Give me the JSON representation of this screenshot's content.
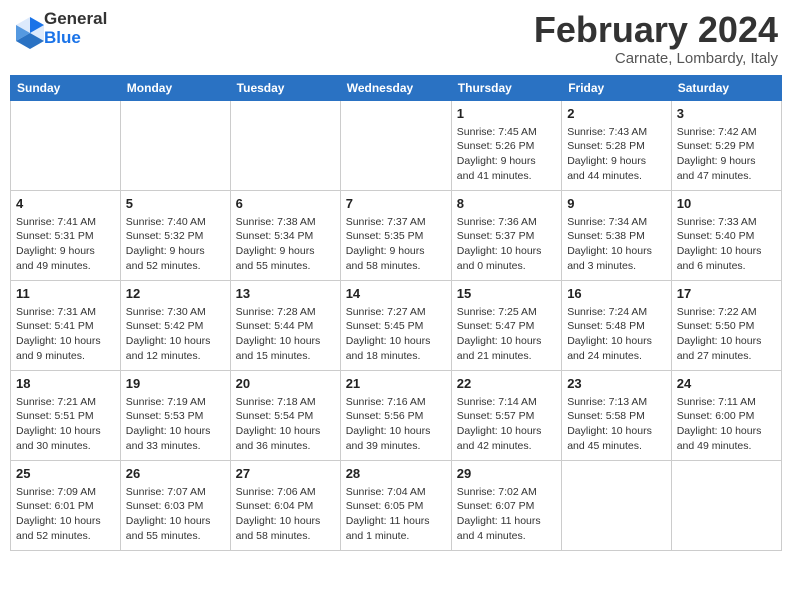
{
  "header": {
    "logo_line1": "General",
    "logo_line2": "Blue",
    "title": "February 2024",
    "subtitle": "Carnate, Lombardy, Italy"
  },
  "weekdays": [
    "Sunday",
    "Monday",
    "Tuesday",
    "Wednesday",
    "Thursday",
    "Friday",
    "Saturday"
  ],
  "weeks": [
    [
      {
        "day": "",
        "info": ""
      },
      {
        "day": "",
        "info": ""
      },
      {
        "day": "",
        "info": ""
      },
      {
        "day": "",
        "info": ""
      },
      {
        "day": "1",
        "info": "Sunrise: 7:45 AM\nSunset: 5:26 PM\nDaylight: 9 hours\nand 41 minutes."
      },
      {
        "day": "2",
        "info": "Sunrise: 7:43 AM\nSunset: 5:28 PM\nDaylight: 9 hours\nand 44 minutes."
      },
      {
        "day": "3",
        "info": "Sunrise: 7:42 AM\nSunset: 5:29 PM\nDaylight: 9 hours\nand 47 minutes."
      }
    ],
    [
      {
        "day": "4",
        "info": "Sunrise: 7:41 AM\nSunset: 5:31 PM\nDaylight: 9 hours\nand 49 minutes."
      },
      {
        "day": "5",
        "info": "Sunrise: 7:40 AM\nSunset: 5:32 PM\nDaylight: 9 hours\nand 52 minutes."
      },
      {
        "day": "6",
        "info": "Sunrise: 7:38 AM\nSunset: 5:34 PM\nDaylight: 9 hours\nand 55 minutes."
      },
      {
        "day": "7",
        "info": "Sunrise: 7:37 AM\nSunset: 5:35 PM\nDaylight: 9 hours\nand 58 minutes."
      },
      {
        "day": "8",
        "info": "Sunrise: 7:36 AM\nSunset: 5:37 PM\nDaylight: 10 hours\nand 0 minutes."
      },
      {
        "day": "9",
        "info": "Sunrise: 7:34 AM\nSunset: 5:38 PM\nDaylight: 10 hours\nand 3 minutes."
      },
      {
        "day": "10",
        "info": "Sunrise: 7:33 AM\nSunset: 5:40 PM\nDaylight: 10 hours\nand 6 minutes."
      }
    ],
    [
      {
        "day": "11",
        "info": "Sunrise: 7:31 AM\nSunset: 5:41 PM\nDaylight: 10 hours\nand 9 minutes."
      },
      {
        "day": "12",
        "info": "Sunrise: 7:30 AM\nSunset: 5:42 PM\nDaylight: 10 hours\nand 12 minutes."
      },
      {
        "day": "13",
        "info": "Sunrise: 7:28 AM\nSunset: 5:44 PM\nDaylight: 10 hours\nand 15 minutes."
      },
      {
        "day": "14",
        "info": "Sunrise: 7:27 AM\nSunset: 5:45 PM\nDaylight: 10 hours\nand 18 minutes."
      },
      {
        "day": "15",
        "info": "Sunrise: 7:25 AM\nSunset: 5:47 PM\nDaylight: 10 hours\nand 21 minutes."
      },
      {
        "day": "16",
        "info": "Sunrise: 7:24 AM\nSunset: 5:48 PM\nDaylight: 10 hours\nand 24 minutes."
      },
      {
        "day": "17",
        "info": "Sunrise: 7:22 AM\nSunset: 5:50 PM\nDaylight: 10 hours\nand 27 minutes."
      }
    ],
    [
      {
        "day": "18",
        "info": "Sunrise: 7:21 AM\nSunset: 5:51 PM\nDaylight: 10 hours\nand 30 minutes."
      },
      {
        "day": "19",
        "info": "Sunrise: 7:19 AM\nSunset: 5:53 PM\nDaylight: 10 hours\nand 33 minutes."
      },
      {
        "day": "20",
        "info": "Sunrise: 7:18 AM\nSunset: 5:54 PM\nDaylight: 10 hours\nand 36 minutes."
      },
      {
        "day": "21",
        "info": "Sunrise: 7:16 AM\nSunset: 5:56 PM\nDaylight: 10 hours\nand 39 minutes."
      },
      {
        "day": "22",
        "info": "Sunrise: 7:14 AM\nSunset: 5:57 PM\nDaylight: 10 hours\nand 42 minutes."
      },
      {
        "day": "23",
        "info": "Sunrise: 7:13 AM\nSunset: 5:58 PM\nDaylight: 10 hours\nand 45 minutes."
      },
      {
        "day": "24",
        "info": "Sunrise: 7:11 AM\nSunset: 6:00 PM\nDaylight: 10 hours\nand 49 minutes."
      }
    ],
    [
      {
        "day": "25",
        "info": "Sunrise: 7:09 AM\nSunset: 6:01 PM\nDaylight: 10 hours\nand 52 minutes."
      },
      {
        "day": "26",
        "info": "Sunrise: 7:07 AM\nSunset: 6:03 PM\nDaylight: 10 hours\nand 55 minutes."
      },
      {
        "day": "27",
        "info": "Sunrise: 7:06 AM\nSunset: 6:04 PM\nDaylight: 10 hours\nand 58 minutes."
      },
      {
        "day": "28",
        "info": "Sunrise: 7:04 AM\nSunset: 6:05 PM\nDaylight: 11 hours\nand 1 minute."
      },
      {
        "day": "29",
        "info": "Sunrise: 7:02 AM\nSunset: 6:07 PM\nDaylight: 11 hours\nand 4 minutes."
      },
      {
        "day": "",
        "info": ""
      },
      {
        "day": "",
        "info": ""
      }
    ]
  ]
}
